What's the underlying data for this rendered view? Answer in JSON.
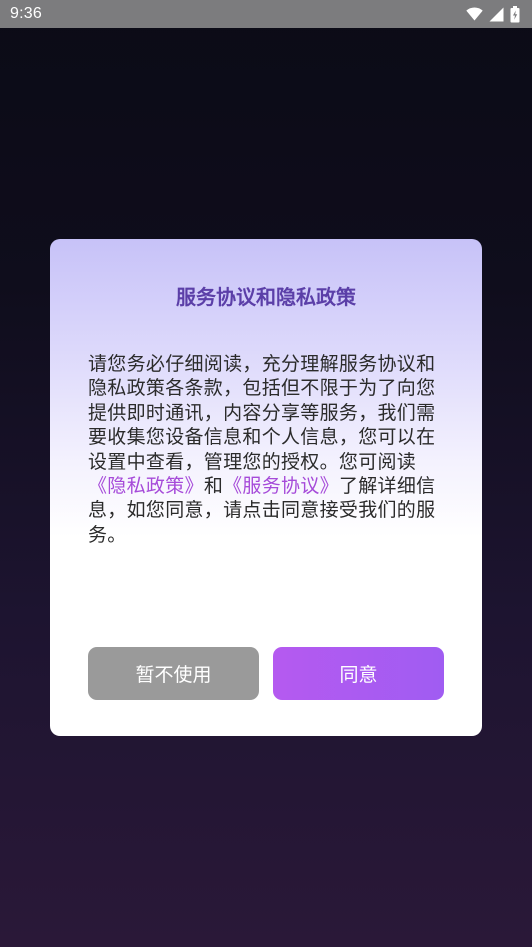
{
  "status_bar": {
    "time": "9:36",
    "icons": [
      "wifi-icon",
      "signal-icon",
      "battery-icon"
    ]
  },
  "dialog": {
    "title": "服务协议和隐私政策",
    "body_intro": "请您务必仔细阅读，充分理解服务协议和隐私政策各条款，包括但不限于为了向您提供即时通讯，内容分享等服务，我们需要收集您设备信息和个人信息，您可以在设置中查看，管理您的授权。您可阅读",
    "privacy_link": "《隐私政策》",
    "connector": "和",
    "service_link": "《服务协议》",
    "body_outro": "了解详细信息，如您同意，请点击同意接受我们的服务。",
    "decline_label": "暂不使用",
    "agree_label": "同意"
  },
  "colors": {
    "title": "#5b3fa8",
    "link": "#a64bd9",
    "decline_button": "#9a9a9a",
    "agree_button": "#b55af0"
  }
}
